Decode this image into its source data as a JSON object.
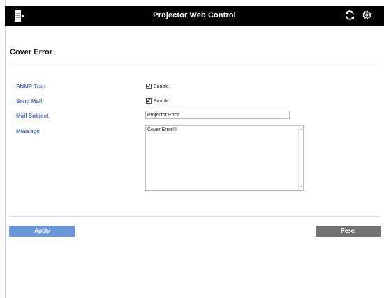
{
  "header": {
    "title": "Projector Web Control",
    "menu_icon": "menu-export-icon",
    "refresh_icon": "refresh-icon",
    "settings_icon": "gear-icon"
  },
  "page": {
    "title": "Cover Error"
  },
  "form": {
    "snmp_trap": {
      "label": "SNMP Trap",
      "checkbox_label": "Enable",
      "checked": true
    },
    "send_mail": {
      "label": "Send Mail",
      "checkbox_label": "Enable",
      "checked": true
    },
    "mail_subject": {
      "label": "Mail Subject",
      "value": "Projector Error"
    },
    "message": {
      "label": "Message",
      "value": "Cover Error!!!"
    }
  },
  "actions": {
    "apply_label": "Apply",
    "reset_label": "Reset"
  },
  "colors": {
    "topbar": "#000000",
    "label": "#4f6fb8",
    "apply": "#6d97d8",
    "reset": "#737373"
  }
}
